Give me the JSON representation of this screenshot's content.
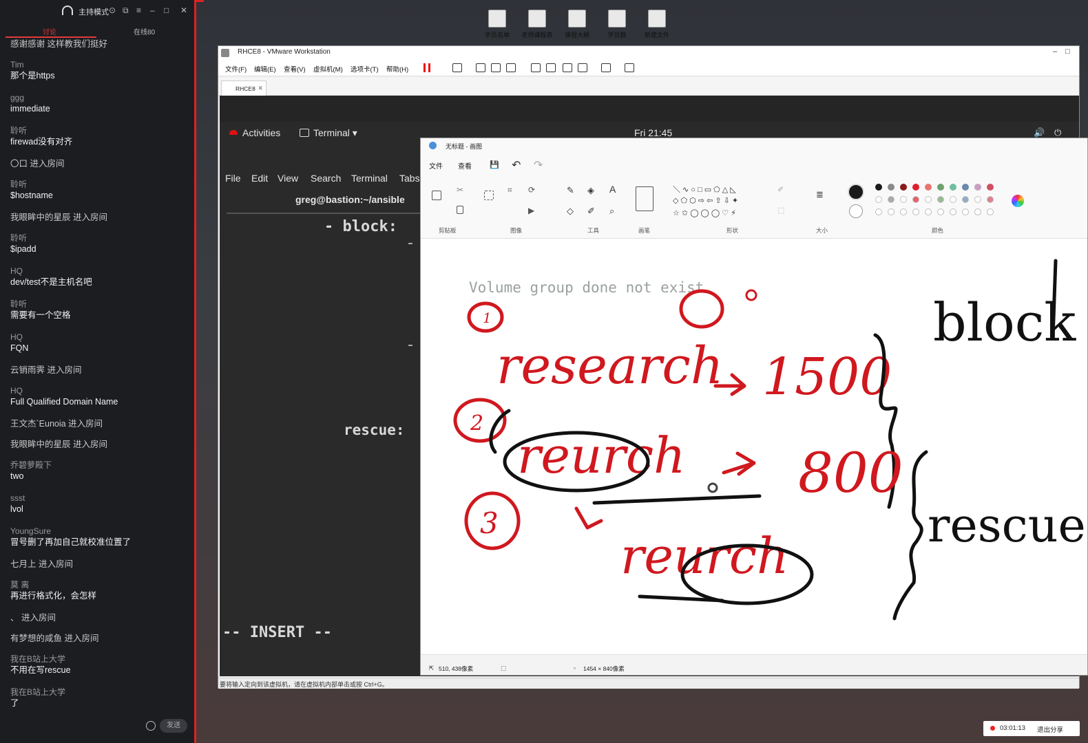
{
  "chat": {
    "mode_label": "主持模式",
    "tabs": [
      "讨论",
      "在线80"
    ],
    "messages": [
      {
        "user": "",
        "text": "感谢感谢  这样教我们挺好"
      },
      {
        "user": "Tim",
        "text": "那个是https"
      },
      {
        "user": "ggg",
        "text": "immediate"
      },
      {
        "user": "聆听",
        "text": "firewad没有对齐"
      },
      {
        "user": "",
        "text": "〇口 进入房间"
      },
      {
        "user": "聆听",
        "text": "$hostname"
      },
      {
        "user": "",
        "text": "我眼眸中的星辰 进入房间"
      },
      {
        "user": "聆听",
        "text": "$ipadd"
      },
      {
        "user": "HQ",
        "text": "dev/test不是主机名吧"
      },
      {
        "user": "聆听",
        "text": "需要有一个空格"
      },
      {
        "user": "HQ",
        "text": "FQN"
      },
      {
        "user": "",
        "text": "云销雨霁 进入房间"
      },
      {
        "user": "HQ",
        "text": "Full Qualified Domain Name"
      },
      {
        "user": "",
        "text": "王文杰`Eunoia 进入房间"
      },
      {
        "user": "",
        "text": "我眼眸中的星辰 进入房间"
      },
      {
        "user": "乔碧萝殿下",
        "text": "two"
      },
      {
        "user": "ssst",
        "text": "lvol"
      },
      {
        "user": "YoungSure",
        "text": "冒号删了再加自己就校准位置了"
      },
      {
        "user": "",
        "text": "七月上 进入房间"
      },
      {
        "user": "莫 离",
        "text": "再进行格式化，会怎样"
      },
      {
        "user": "",
        "text": "、 进入房间"
      },
      {
        "user": "",
        "text": "有梦想的咸鱼 进入房间"
      },
      {
        "user": "我在B站上大学",
        "text": "不用在写rescue"
      },
      {
        "user": "我在B站上大学",
        "text": "了"
      }
    ],
    "send_label": "发送"
  },
  "desktop_icons": [
    "学员名单",
    "老师课程表",
    "课程大纲",
    "学员群",
    "新建文件"
  ],
  "vmware": {
    "title": "RHCE8 - VMware Workstation",
    "menu": [
      "文件(F)",
      "编辑(E)",
      "查看(V)",
      "虚拟机(M)",
      "选项卡(T)",
      "帮助(H)"
    ],
    "tab": "RHCE8",
    "status": "要将输入定向到该虚拟机，请在虚拟机内部单击或按 Ctrl+G。"
  },
  "guest": {
    "activities": "Activities",
    "terminal_menu": "Terminal ▾",
    "clock": "Fri 21:45",
    "term_menu": [
      "File",
      "Edit",
      "View",
      "Search",
      "Terminal",
      "Tabs"
    ],
    "term_title": "greg@bastion:~/ansible",
    "code_block": "- block:",
    "code_rescue": "rescue:",
    "mode": "-- INSERT --"
  },
  "paint": {
    "title": "无标题 - 画图",
    "menu": [
      "文件",
      "查看"
    ],
    "groups": [
      "剪贴板",
      "图像",
      "工具",
      "画笔",
      "形状",
      "大小",
      "颜色"
    ],
    "status_pos": "510, 438像素",
    "status_size": "1454 × 840像素",
    "canvas_text": "Volume group done not exist",
    "handwriting": {
      "block": "block",
      "research": "research",
      "code1500": "1500",
      "reserch": "reurch",
      "code800": "800",
      "rescue": "rescue",
      "nums": [
        "1",
        "2",
        "3"
      ]
    },
    "colors": [
      "#1a1a1a",
      "#8a8a8a",
      "#8b1a1a",
      "#e01f2f",
      "#e8756f",
      "#6fa06f",
      "#6fbfa0",
      "#6a8ab0",
      "#c7a0c0",
      "#d05060"
    ]
  },
  "recording": {
    "time": "03:01:13",
    "exit": "退出分享"
  }
}
